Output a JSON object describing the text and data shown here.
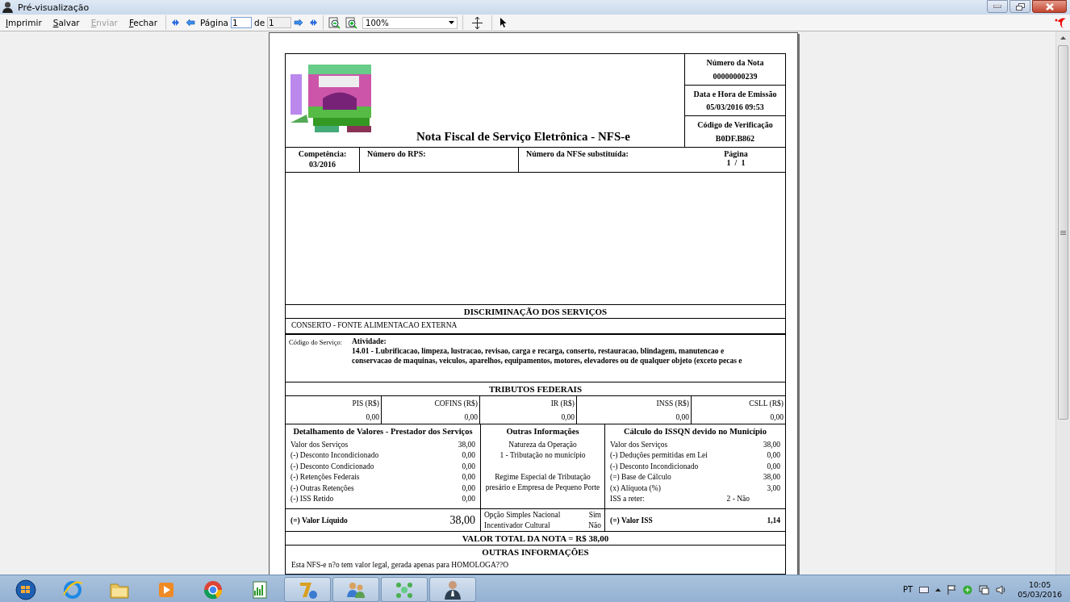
{
  "window": {
    "title": "Pré-visualização"
  },
  "toolbar": {
    "buttons": [
      {
        "label": "Imprimir",
        "disabled": false
      },
      {
        "label": "Salvar",
        "disabled": false
      },
      {
        "label": "Enviar",
        "disabled": true
      },
      {
        "label": "Fechar",
        "disabled": false
      }
    ],
    "page_label": "Página",
    "page_value": "1",
    "of_label": "de",
    "page_total": "1",
    "zoom": "100%"
  },
  "document": {
    "title": "Nota Fiscal de Serviço Eletrônica - NFS-e",
    "header_fields": [
      {
        "label": "Número da Nota",
        "value": "00000000239"
      },
      {
        "label": "Data e Hora de Emissão",
        "value": "05/03/2016 09:53"
      },
      {
        "label": "Código de Verificação",
        "value": "B0DF.B862"
      }
    ],
    "competencia_label": "Competência:",
    "competencia": "03/2016",
    "rps_label": "Número do RPS:",
    "nfse_sub_label": "Número da NFSe substituída:",
    "pagina_label": "Página",
    "pagina": "1  /  1",
    "discriminacao_title": "DISCRIMINAÇÃO DOS SERVIÇOS",
    "discriminacao_text": "CONSERTO - FONTE ALIMENTACAO EXTERNA",
    "codigo_servico_label": "Código do Serviço:",
    "atividade_label": "Atividade:",
    "atividade_text": "14.01 - Lubrificacao, limpeza, lustracao, revisao, carga e recarga, conserto, restauracao, blindagem, manutencao e conservacao de maquinas, veiculos, aparelhos, equipamentos, motores, elevadores ou de qualquer objeto (exceto pecas e",
    "tributos_title": "TRIBUTOS FEDERAIS",
    "tributos": [
      {
        "label": "PIS (R$)",
        "value": "0,00"
      },
      {
        "label": "COFINS (R$)",
        "value": "0,00"
      },
      {
        "label": "IR (R$)",
        "value": "0,00"
      },
      {
        "label": "INSS (R$)",
        "value": "0,00"
      },
      {
        "label": "CSLL (R$)",
        "value": "0,00"
      }
    ],
    "detalhamento": {
      "title": "Detalhamento de Valores - Prestador dos Serviços",
      "rows": [
        {
          "label": "Valor dos Serviços",
          "value": "38,00"
        },
        {
          "label": "(-) Desconto Incondicionado",
          "value": "0,00"
        },
        {
          "label": "(-) Desconto Condicionado",
          "value": "0,00"
        },
        {
          "label": "(-) Retenções Federais",
          "value": "0,00"
        },
        {
          "label": "(-) Outras Retenções",
          "value": "0,00"
        },
        {
          "label": "(-) ISS Retido",
          "value": "0,00"
        }
      ],
      "liquido_label": "(=) Valor Líquido",
      "liquido_value": "38,00"
    },
    "outras": {
      "title": "Outras Informações",
      "groups": [
        [
          "Natureza da Operação",
          "1 - Tributação no município"
        ],
        [
          "Regime Especial de Tributação",
          "presário e Empresa de Pequeno Porte"
        ]
      ],
      "flags": [
        {
          "label": "Opção Simples Nacional",
          "value": "Sim"
        },
        {
          "label": "Incentivador Cultural",
          "value": "Não"
        }
      ]
    },
    "calculo": {
      "title": "Cálculo do ISSQN devido no Município",
      "rows": [
        {
          "label": "Valor dos Serviços",
          "value": "38,00"
        },
        {
          "label": "(-) Deduções permitidas em Lei",
          "value": "0,00"
        },
        {
          "label": "(-) Desconto Incondicionado",
          "value": "0,00"
        },
        {
          "label": "(=) Base de Cálculo",
          "value": "38,00"
        },
        {
          "label": "(x) Alíquota (%)",
          "value": "3,00"
        }
      ],
      "reter_label": "ISS a reter:",
      "reter_value": "2 - Não",
      "iss_label": "(=) Valor ISS",
      "iss_value": "1,14"
    },
    "total": "VALOR TOTAL DA NOTA = R$ 38,00",
    "outras_info_title": "OUTRAS INFORMAÇÕES",
    "outras_info_text": "Esta NFS-e n?o tem valor legal, gerada apenas para HOMOLOGA??O"
  },
  "taskbar": {
    "language": "PT",
    "time": "10:05",
    "date": "05/03/2016"
  }
}
